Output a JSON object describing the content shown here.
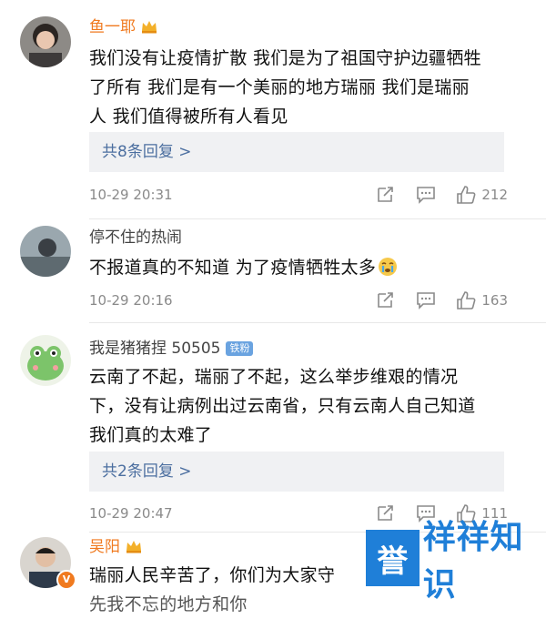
{
  "comments": [
    {
      "author": "鱼一耶",
      "text_lines": [
        "我们没有让疫情扩散 我们是为了祖国守护边疆牺牲",
        "了所有 我们是有一个美丽的地方瑞丽 我们是瑞丽",
        "人 我们值得被所有人看见"
      ],
      "replies_label": "共8条回复 >",
      "timestamp": "10-29 20:31",
      "likes": "212"
    },
    {
      "author": "停不住的热闹",
      "text_lines": [
        "不报道真的不知道 为了疫情牺牲太多"
      ],
      "timestamp": "10-29 20:16",
      "likes": "163"
    },
    {
      "author": "我是猪猪捏 50505",
      "badge": "铁粉",
      "text_lines": [
        "云南了不起，瑞丽了不起，这么举步维艰的情况",
        "下，没有让病例出过云南省，只有云南人自己知道",
        "我们真的太难了"
      ],
      "replies_label": "共2条回复 >",
      "timestamp": "10-29 20:47",
      "likes": "111"
    },
    {
      "author": "吴阳",
      "text_lines": [
        "瑞丽人民辛苦了，你们为大家守",
        "先我不忘的地方和你"
      ]
    }
  ],
  "watermark": {
    "tile": "誉",
    "text": "祥祥知识"
  },
  "colors": {
    "vip_name": "#f07a1f",
    "reply_link": "#4c6fa0",
    "brand_blue": "#1f7fd8"
  }
}
